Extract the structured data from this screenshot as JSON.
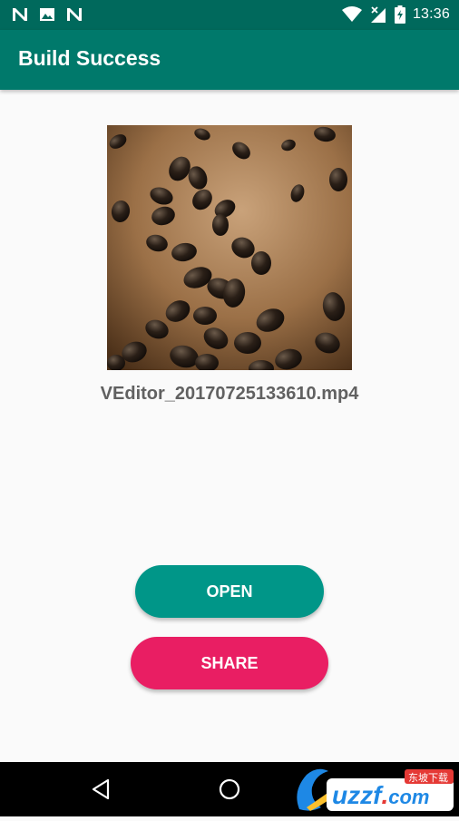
{
  "status_bar": {
    "time": "13:36",
    "left_icons": [
      "n-notification-icon",
      "image-notification-icon",
      "n-notification-icon"
    ],
    "right_icons": [
      "wifi-icon",
      "cell-signal-icon",
      "battery-icon"
    ]
  },
  "app_bar": {
    "title": "Build Success"
  },
  "media": {
    "thumbnail_icon": "coffee-beans-thumbnail",
    "filename": "VEditor_20170725133610.mp4"
  },
  "actions": {
    "open_label": "OPEN",
    "share_label": "SHARE"
  },
  "colors": {
    "status_bar": "#00695c",
    "app_bar": "#00796b",
    "open_button": "#009688",
    "share_button": "#e91e63",
    "background": "#fafafa"
  },
  "watermark": {
    "text": "uzzf.com",
    "sub_text": "东坡下载"
  }
}
